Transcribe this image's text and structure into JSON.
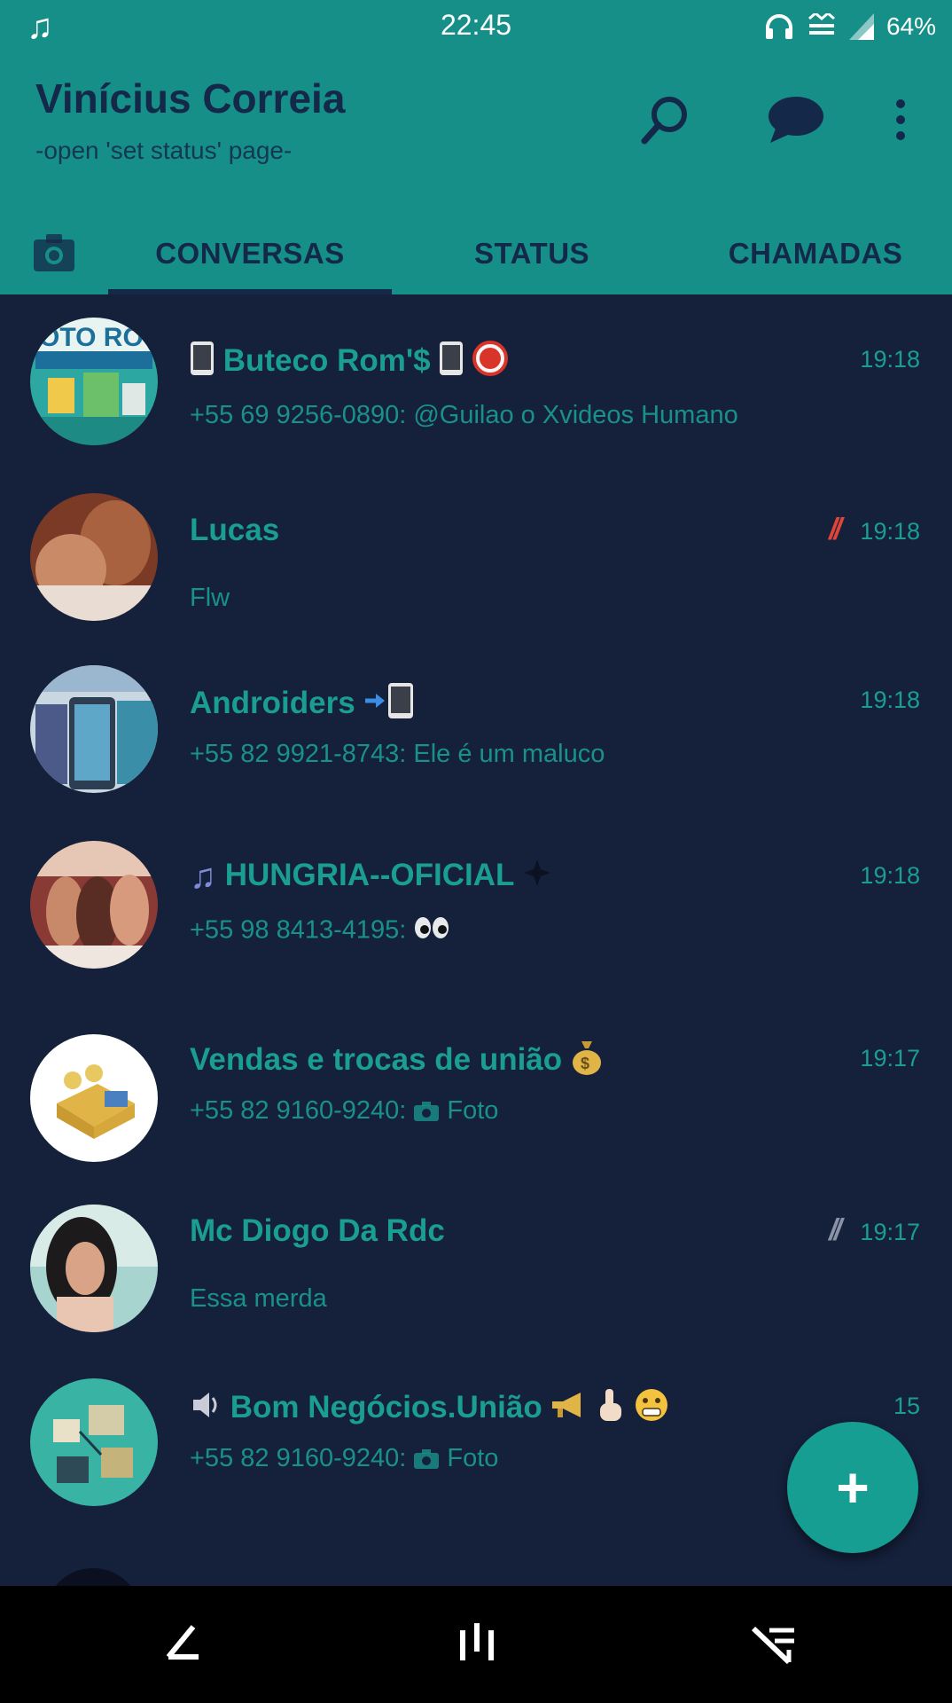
{
  "status_bar": {
    "time": "22:45",
    "battery": "64%",
    "icons": [
      "music-note-icon",
      "headphones-icon",
      "data-icon",
      "signal-icon"
    ]
  },
  "app_bar": {
    "title": "Vinícius Correia",
    "subtitle": "-open 'set status' page-",
    "actions": [
      "search-icon",
      "chat-icon",
      "more-options-icon"
    ]
  },
  "tabs": [
    {
      "label": "CONVERSAS",
      "active": true
    },
    {
      "label": "STATUS",
      "active": false
    },
    {
      "label": "CHAMADAS",
      "active": false
    }
  ],
  "chats": [
    {
      "name": "Buteco Rom'$",
      "message": "+55 69 9256-0890: @Guilao o Xvideos Humano",
      "time": "19:18"
    },
    {
      "name": "Lucas",
      "message": "Flw",
      "time": "19:18",
      "ticks": "//"
    },
    {
      "name": "Androiders",
      "message": "+55 82 9921-8743: Ele é um maluco",
      "time": "19:18"
    },
    {
      "name": "HUNGRIA--OFICIAL",
      "message": "+55 98 8413-4195:",
      "time": "19:18"
    },
    {
      "name": "Vendas e trocas de união",
      "message_prefix": "+55 82 9160-9240:",
      "message": "Foto",
      "time": "19:17"
    },
    {
      "name": "Mc Diogo Da Rdc",
      "message": "Essa merda",
      "time": "19:17",
      "ticks": "//"
    },
    {
      "name": "Bom Negócios.União",
      "message_prefix": "+55 82 9160-9240:",
      "message": "Foto",
      "time": "15"
    }
  ],
  "fab": {
    "label": "+"
  },
  "colors": {
    "header": "#168f88",
    "background": "#15203b",
    "accent_text": "#1a9e92",
    "header_text": "#14284a",
    "red_ticks": "#e0453a",
    "grey_ticks": "#8a93a6"
  }
}
